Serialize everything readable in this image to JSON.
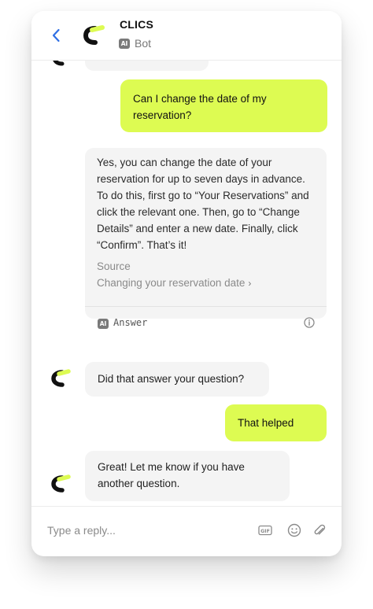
{
  "header": {
    "brand_name": "CLICS",
    "ai_badge": "AI",
    "bot_label": "Bot"
  },
  "colors": {
    "accent": "#ddfb52",
    "bot_bubble": "#f4f4f4",
    "text": "#1f1f1f",
    "muted": "#8a8a8a",
    "back_arrow": "#2f6fe4"
  },
  "messages": [
    {
      "sender": "user",
      "text": "Can I change the date of my reservation?"
    },
    {
      "sender": "bot",
      "text": "Yes, you can change the date of your reservation for up to seven days in advance. To do this, first go to “Your Reservations” and click the relevant one. Then, go to “Change Details” and enter a new date. Finally, click “Confirm”. That’s it!",
      "source_title": "Source",
      "source_link": "Changing your reservation date",
      "ai_badge": "AI",
      "tag": "Answer"
    },
    {
      "sender": "bot",
      "text": "Did that answer your question?"
    },
    {
      "sender": "user",
      "text": "That helped"
    },
    {
      "sender": "bot",
      "text": "Great! Let me know if you have another question."
    }
  ],
  "composer": {
    "placeholder": "Type a reply...",
    "gif_label": "GIF"
  },
  "icons": {
    "back": "chevron-left-icon",
    "logo": "clics-logo",
    "info": "info-icon",
    "gif": "gif-icon",
    "emoji": "emoji-icon",
    "attach": "paperclip-icon"
  }
}
